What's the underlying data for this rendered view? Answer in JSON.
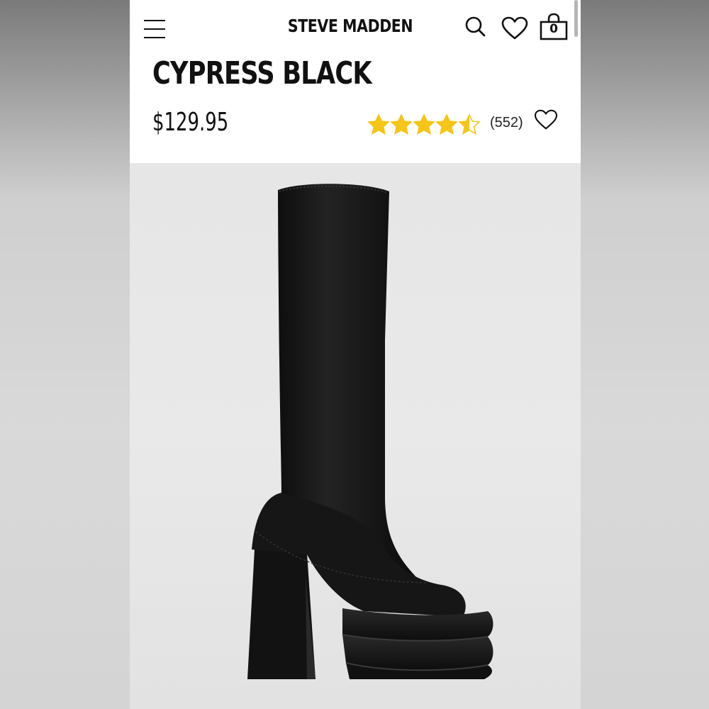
{
  "header": {
    "brand": "STEVE MADDEN",
    "bag_count": "0"
  },
  "product": {
    "name": "CYPRESS BLACK",
    "price": "$129.95",
    "rating": 4.5,
    "review_count": "(552)",
    "star_color": "#f5c518"
  },
  "icons": {
    "menu": "hamburger-menu-icon",
    "search": "search-icon",
    "wishlist": "heart-icon",
    "bag": "shopping-bag-icon"
  }
}
